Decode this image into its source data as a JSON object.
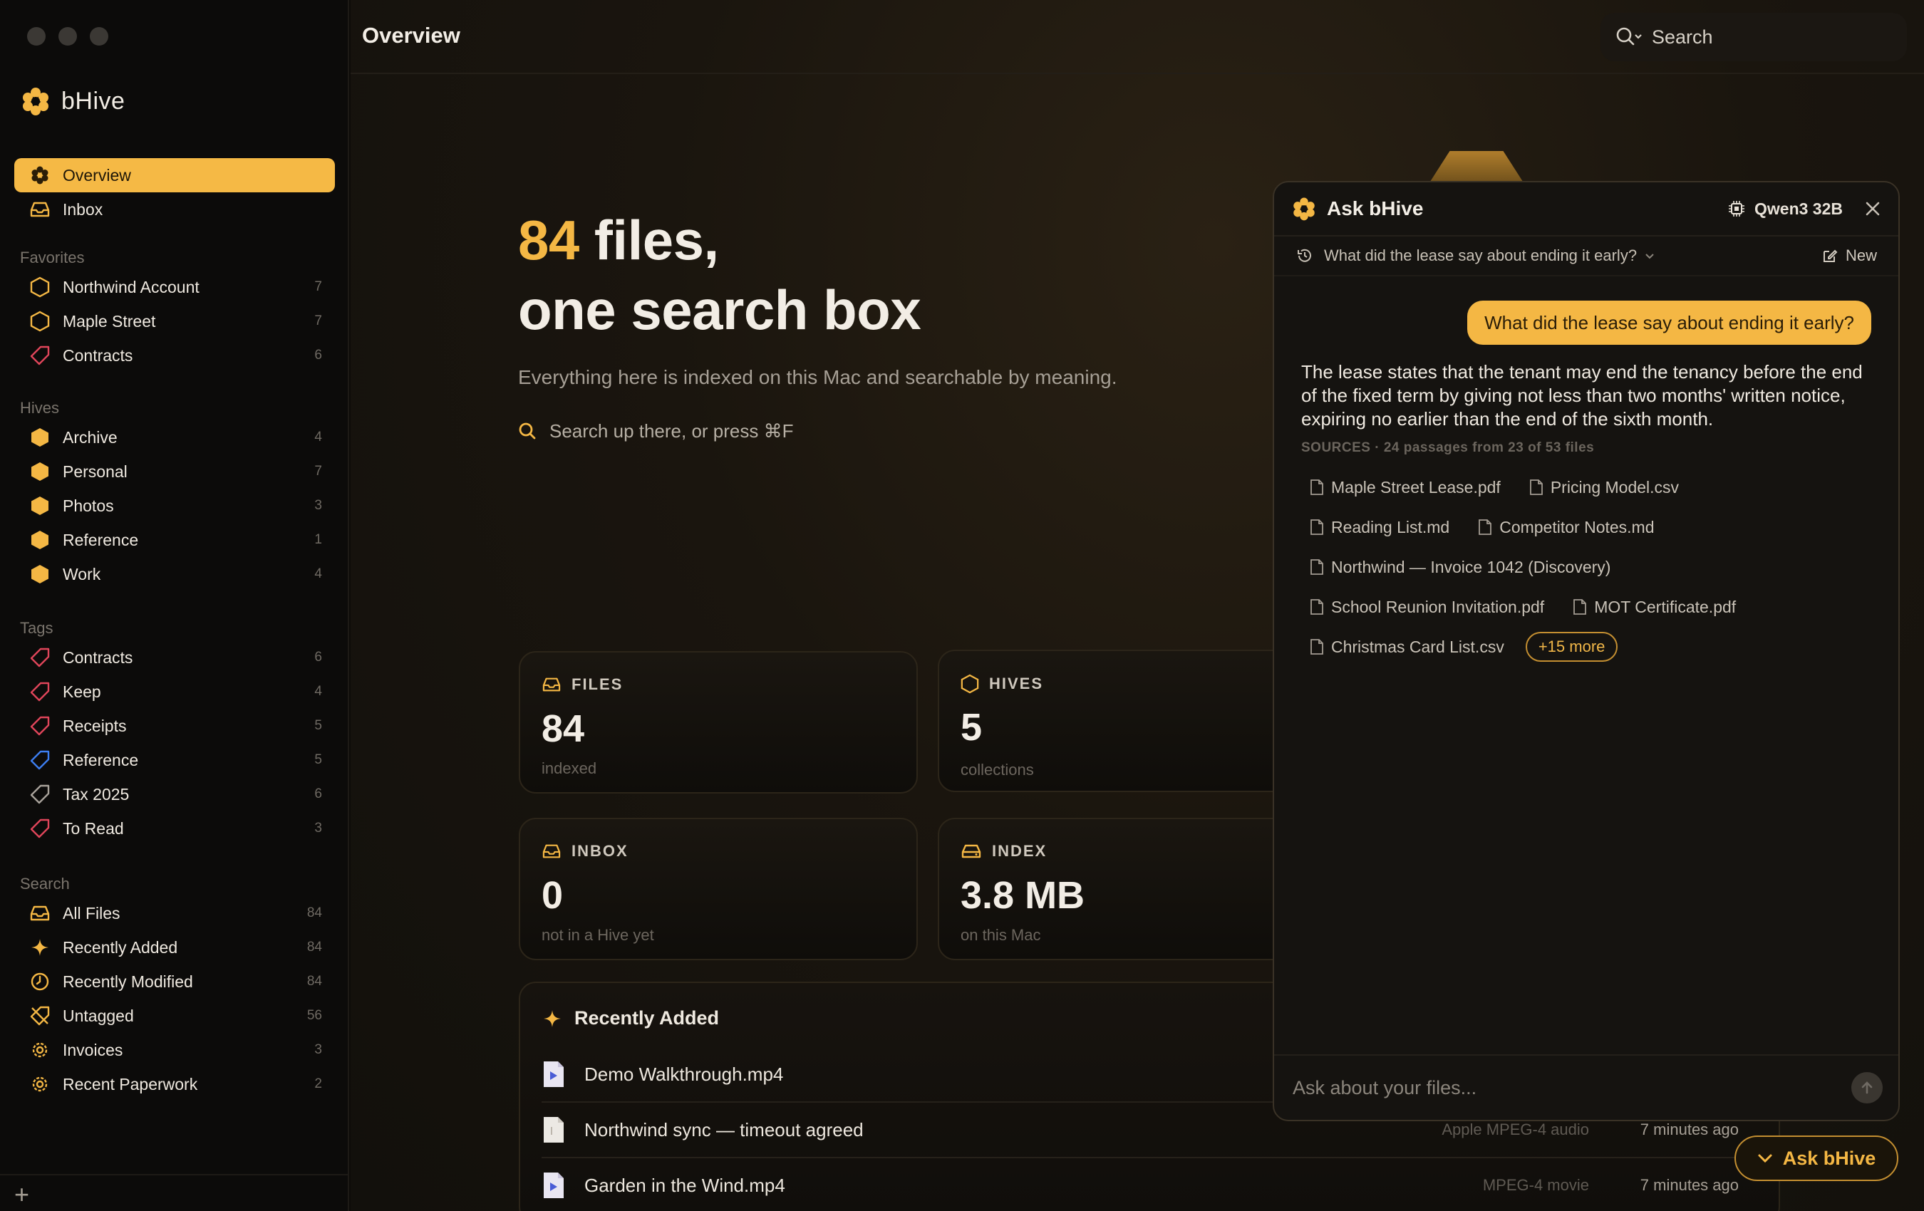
{
  "app": {
    "name": "bHive",
    "page_title": "Overview"
  },
  "search": {
    "label": "Search"
  },
  "colors": {
    "accent": "#f4b744",
    "tag_red": "#e0455a",
    "tag_blue": "#3d7ef0",
    "tag_grey": "#a8a29a"
  },
  "sidebar": {
    "top": [
      {
        "label": "Overview",
        "icon": "hive-icon"
      },
      {
        "label": "Inbox",
        "icon": "inbox-icon"
      }
    ],
    "favorites_header": "Favorites",
    "favorites": [
      {
        "label": "Northwind Account",
        "count": "7"
      },
      {
        "label": "Maple Street",
        "count": "7"
      },
      {
        "label": "Contracts",
        "count": "6"
      }
    ],
    "hives_header": "Hives",
    "hives": [
      {
        "label": "Archive",
        "count": "4"
      },
      {
        "label": "Personal",
        "count": "7"
      },
      {
        "label": "Photos",
        "count": "3"
      },
      {
        "label": "Reference",
        "count": "1"
      },
      {
        "label": "Work",
        "count": "4"
      }
    ],
    "tags_header": "Tags",
    "tags": [
      {
        "label": "Contracts",
        "count": "6",
        "color": "red"
      },
      {
        "label": "Keep",
        "count": "4",
        "color": "red"
      },
      {
        "label": "Receipts",
        "count": "5",
        "color": "red"
      },
      {
        "label": "Reference",
        "count": "5",
        "color": "blue"
      },
      {
        "label": "Tax 2025",
        "count": "6",
        "color": "grey"
      },
      {
        "label": "To Read",
        "count": "3",
        "color": "red"
      }
    ],
    "search_header": "Search",
    "searches": [
      {
        "label": "All Files",
        "count": "84"
      },
      {
        "label": "Recently Added",
        "count": "84"
      },
      {
        "label": "Recently Modified",
        "count": "84"
      },
      {
        "label": "Untagged",
        "count": "56"
      },
      {
        "label": "Invoices",
        "count": "3"
      },
      {
        "label": "Recent Paperwork",
        "count": "2"
      }
    ],
    "add_label": "+"
  },
  "hero": {
    "count": "84",
    "title_rest": " files,",
    "title_line2": "one search box",
    "subtitle": "Everything here is indexed on this Mac and searchable by meaning.",
    "hint": "Search up there, or press ⌘F"
  },
  "stats": [
    {
      "head": "FILES",
      "value": "84",
      "sub": "indexed"
    },
    {
      "head": "HIVES",
      "value": "5",
      "sub": "collections"
    },
    {
      "head": "INBOX",
      "value": "0",
      "sub": "not in a Hive yet"
    },
    {
      "head": "INDEX",
      "value": "3.8 MB",
      "sub": "on this Mac"
    }
  ],
  "recent": {
    "title": "Recently Added",
    "rows": [
      {
        "name": "Demo Walkthrough.mp4",
        "kind": "",
        "time": ""
      },
      {
        "name": "Northwind sync — timeout agreed",
        "kind": "Apple MPEG-4 audio",
        "time": "7 minutes ago"
      },
      {
        "name": "Garden in the Wind.mp4",
        "kind": "MPEG-4 movie",
        "time": "7 minutes ago"
      }
    ]
  },
  "ask": {
    "title": "Ask bHive",
    "model": "Qwen3 32B",
    "history_question": "What did the lease say about ending it early?",
    "new_label": "New",
    "user_message": "What did the lease say about ending it early?",
    "answer": "The lease states that the tenant may end the tenancy before the end of the fixed term by giving not less than two months' written notice, expiring no earlier than the end of the sixth month.",
    "sources_header": "SOURCES · 24 passages from 23 of 53 files",
    "sources": [
      [
        "Maple Street Lease.pdf",
        "Pricing Model.csv"
      ],
      [
        "Reading List.md",
        "Competitor Notes.md"
      ],
      [
        "Northwind — Invoice 1042 (Discovery)"
      ],
      [
        "School Reunion Invitation.pdf",
        "MOT Certificate.pdf"
      ],
      [
        "Christmas Card List.csv"
      ]
    ],
    "more_label": "+15 more",
    "input_placeholder": "Ask about your files...",
    "toggle_label": "Ask bHive"
  }
}
